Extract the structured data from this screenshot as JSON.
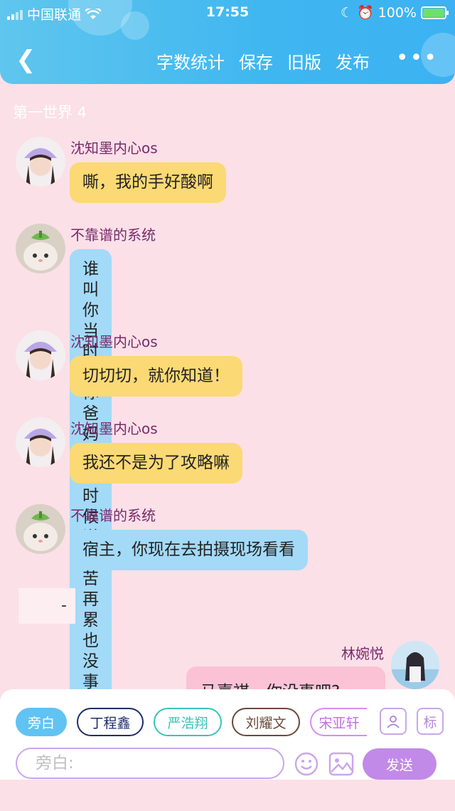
{
  "status": {
    "carrier": "中国联通",
    "time": "17:55",
    "battery": "100%"
  },
  "nav": {
    "word_count": "字数统计",
    "save": "保存",
    "old_version": "旧版",
    "publish": "发布",
    "more": "•••"
  },
  "world_label": "第一世界 4",
  "messages": [
    {
      "name": "沈知墨内心os",
      "text": "嘶，我的手好酸啊",
      "color": "yellow"
    },
    {
      "name": "不靠谱的系统",
      "text": "谁叫你当时跟你爸妈说的时候说\n再苦再累也没事的",
      "color": "blue"
    },
    {
      "name": "沈知墨内心os",
      "text": "切切切，就你知道！",
      "color": "yellow"
    },
    {
      "name": "沈知墨内心os",
      "text": "我还不是为了攻略嘛",
      "color": "yellow"
    },
    {
      "name": "不靠谱的系统",
      "text": "宿主，你现在去拍摄现场看看",
      "color": "blue"
    }
  ],
  "dash": "-",
  "right_message": {
    "name": "林婉悦",
    "text": "马嘉祺，你没事吧?"
  },
  "chips": [
    "旁白",
    "丁程鑫",
    "严浩翔",
    "刘耀文",
    "宋亚轩"
  ],
  "icon_mark": "标",
  "input_placeholder": "旁白:",
  "send": "发送"
}
